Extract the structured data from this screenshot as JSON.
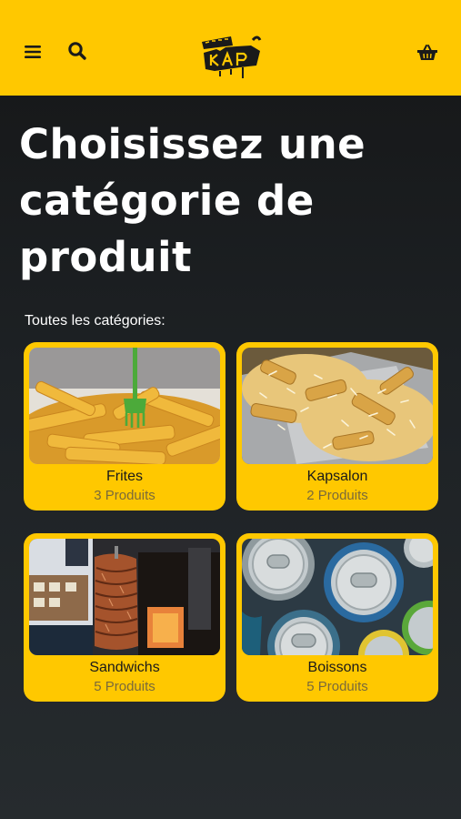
{
  "header": {
    "menu_icon": "hamburger-menu-icon",
    "search_icon": "search-icon",
    "cart_icon": "shopping-basket-icon",
    "logo_alt": "Street Kap",
    "background_color": "#ffc800"
  },
  "page": {
    "title": "Choisissez une catégorie de produit",
    "subtitle": "Toutes les catégories:"
  },
  "categories": [
    {
      "name": "Frites",
      "count": "3 Produits"
    },
    {
      "name": "Kapsalon",
      "count": "2 Produits"
    },
    {
      "name": "Sandwichs",
      "count": "5 Produits"
    },
    {
      "name": "Boissons",
      "count": "5 Produits"
    }
  ],
  "colors": {
    "accent": "#ffc800",
    "background_dark": "#1d2124",
    "text_light": "#ffffff"
  }
}
